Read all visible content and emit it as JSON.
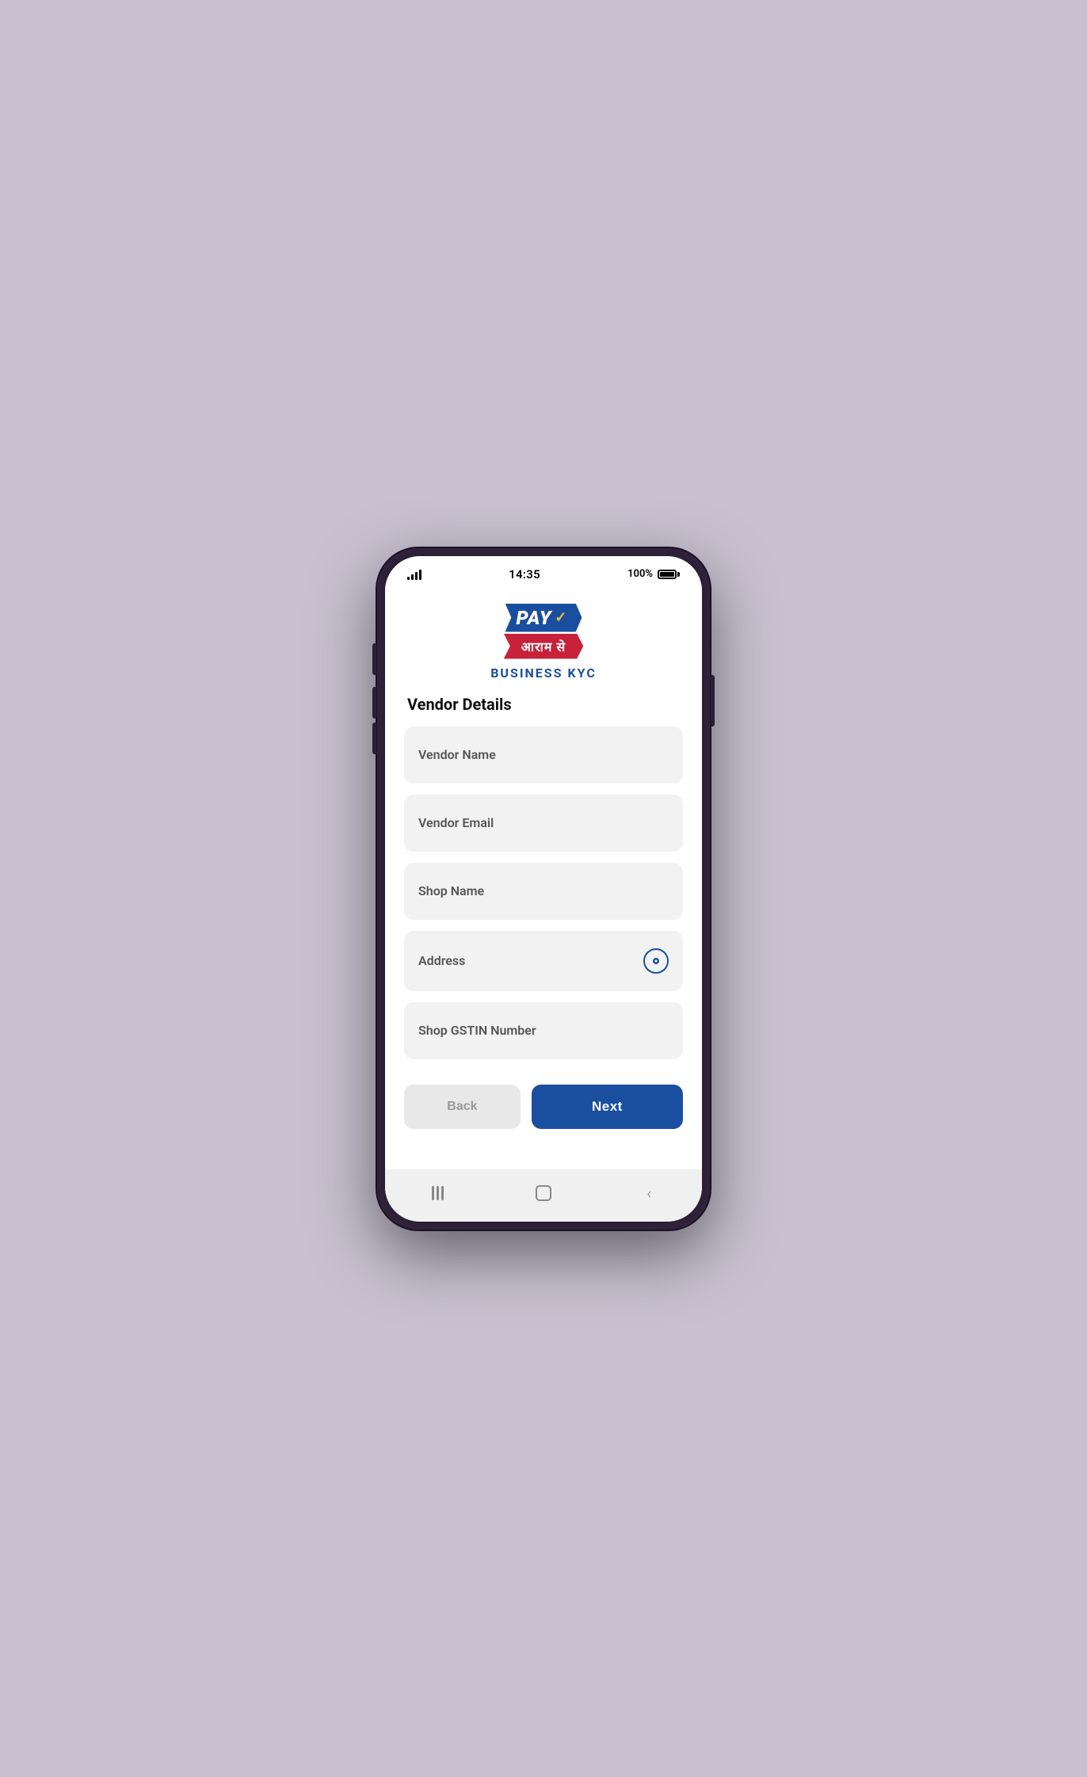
{
  "status_bar": {
    "time": "14:35",
    "battery_text": "100%"
  },
  "logo": {
    "pay_text": "PAY",
    "hindi_text": "आराम से",
    "kyc_label": "BUSINESS KYC"
  },
  "form": {
    "section_title": "Vendor Details",
    "fields": [
      {
        "placeholder": "Vendor Name",
        "has_location": false
      },
      {
        "placeholder": "Vendor Email",
        "has_location": false
      },
      {
        "placeholder": "Shop Name",
        "has_location": false
      },
      {
        "placeholder": "Address",
        "has_location": true
      },
      {
        "placeholder": "Shop GSTIN Number",
        "has_location": false
      }
    ],
    "back_label": "Back",
    "next_label": "Next"
  }
}
